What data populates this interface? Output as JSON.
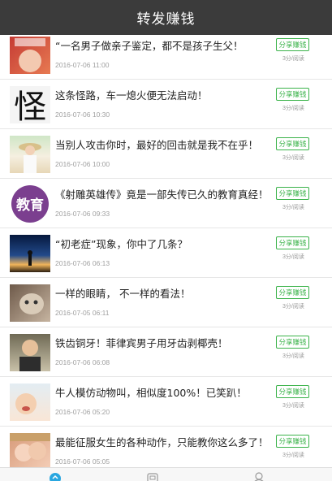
{
  "header": {
    "title": "转发赚钱"
  },
  "articles": [
    {
      "title": "“一名男子做亲子鉴定，都不是孩子生父！",
      "date": "2016-07-06 11:00",
      "share_label": "分享赚钱",
      "reward": "3分/阅读",
      "thumb_icon": "child-photo-thumbnail"
    },
    {
      "title": "这条怪路，车一熄火便无法启动！",
      "date": "2016-07-06 10:30",
      "share_label": "分享赚钱",
      "reward": "3分/阅读",
      "thumb_icon": "calligraphy-character-thumbnail",
      "thumb_text": "怪"
    },
    {
      "title": "当别人攻击你时，最好的回击就是我不在乎！",
      "date": "2016-07-06 10:00",
      "share_label": "分享赚钱",
      "reward": "3分/阅读",
      "thumb_icon": "girl-in-field-thumbnail"
    },
    {
      "title": "《射雕英雄传》竟是一部失传已久的教育真经！",
      "date": "2016-07-06 09:33",
      "share_label": "分享赚钱",
      "reward": "3分/阅读",
      "thumb_icon": "education-badge-thumbnail",
      "thumb_text": "教育"
    },
    {
      "title": "“初老症”现象，你中了几条？",
      "date": "2016-07-06 06:13",
      "share_label": "分享赚钱",
      "reward": "3分/阅读",
      "thumb_icon": "sunset-silhouette-thumbnail"
    },
    {
      "title": "一样的眼睛， 不一样的看法！",
      "date": "2016-07-05 06:11",
      "share_label": "分享赚钱",
      "reward": "3分/阅读",
      "thumb_icon": "cat-photo-thumbnail"
    },
    {
      "title": "铁齿铜牙！菲律宾男子用牙齿剥椰壳！",
      "date": "2016-07-06 06:08",
      "share_label": "分享赚钱",
      "reward": "3分/阅读",
      "thumb_icon": "man-portrait-thumbnail"
    },
    {
      "title": "牛人模仿动物叫，相似度100%！已笑趴！",
      "date": "2016-07-06 05:20",
      "share_label": "分享赚钱",
      "reward": "3分/阅读",
      "thumb_icon": "baby-photo-thumbnail"
    },
    {
      "title": "最能征服女生的各种动作，只能教你这么多了！",
      "date": "2016-07-06 05:05",
      "share_label": "分享赚钱",
      "reward": "3分/阅读",
      "thumb_icon": "kids-kissing-thumbnail"
    }
  ],
  "colors": {
    "header_bg": "#3b3b3b",
    "accent_green": "#3bb34a",
    "tab_active": "#2aa7e0"
  },
  "tabs": [
    {
      "icon": "home-icon",
      "active": true
    },
    {
      "icon": "market-icon",
      "active": false
    },
    {
      "icon": "profile-icon",
      "active": false
    }
  ]
}
